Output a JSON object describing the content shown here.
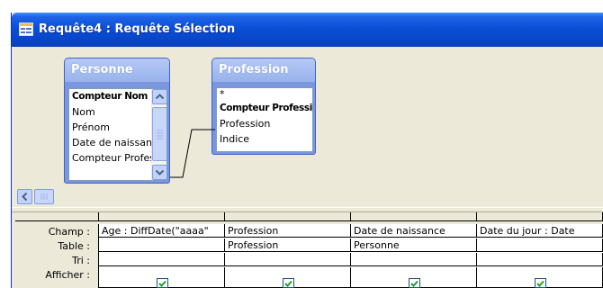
{
  "window": {
    "title": "Requête4 : Requête Sélection"
  },
  "tables": [
    {
      "name": "Personne",
      "fields": [
        "Compteur Nom",
        "Nom",
        "Prénom",
        "Date de naissance",
        "Compteur Profession"
      ],
      "key_field_index": 0
    },
    {
      "name": "Profession",
      "fields": [
        "*",
        "Compteur Profession",
        "Profession",
        "Indice"
      ],
      "key_field_index": 1
    }
  ],
  "grid": {
    "row_labels": [
      "Champ :",
      "Table :",
      "Tri :",
      "Afficher :"
    ],
    "columns": [
      {
        "champ": "Age : DiffDate(\"aaaa\"",
        "table": "",
        "tri": "",
        "afficher": true
      },
      {
        "champ": "Profession",
        "table": "Profession",
        "tri": "",
        "afficher": true
      },
      {
        "champ": "Date de naissance",
        "table": "Personne",
        "tri": "",
        "afficher": true
      },
      {
        "champ": "Date du jour : Date",
        "table": "",
        "tri": "",
        "afficher": true
      }
    ]
  },
  "colors": {
    "titlebar": "#0a4fd6",
    "table_frame": "#7a96df",
    "window_bg": "#ece9d8",
    "checkmark": "#21a121"
  },
  "icons": [
    "query-window-icon",
    "scroll-up-icon",
    "scroll-down-icon",
    "scroll-left-icon",
    "checkmark-icon"
  ]
}
